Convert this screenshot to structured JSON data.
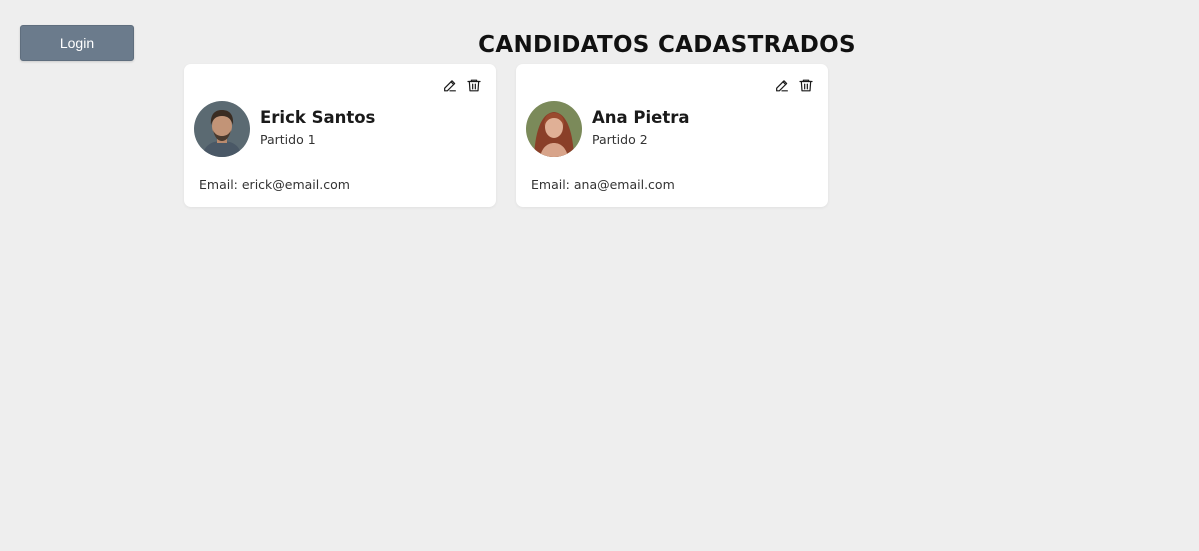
{
  "header": {
    "login_label": "Login",
    "title": "CANDIDATOS CADASTRADOS"
  },
  "colors": {
    "background": "#eeeeee",
    "login_button": "#6b7b8c",
    "card": "#ffffff"
  },
  "candidates": [
    {
      "name": "Erick Santos",
      "party": "Partido 1",
      "email": "Email: erick@email.com",
      "edit_icon": "pencil-icon",
      "delete_icon": "trash-icon"
    },
    {
      "name": "Ana Pietra",
      "party": "Partido 2",
      "email": "Email: ana@email.com",
      "edit_icon": "pencil-icon",
      "delete_icon": "trash-icon"
    }
  ]
}
